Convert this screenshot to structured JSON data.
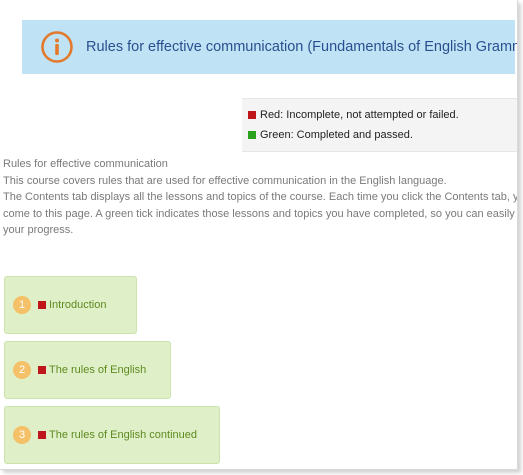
{
  "header": {
    "icon": "info-icon",
    "title": "Rules for effective communication (Fundamentals of English Grammar)"
  },
  "legend": {
    "items": [
      {
        "color": "#c0151a",
        "label": "Red: Incomplete, not attempted or failed."
      },
      {
        "color": "#2aa21d",
        "label": "Green: Completed and passed."
      }
    ]
  },
  "description": {
    "lines": [
      "Rules for effective communication",
      "This course covers rules that are used for effective communication in the English language.",
      "The Contents tab displays all the lessons and topics of the course. Each time you click the Contents tab, you w",
      "come to this page. A green tick indicates those lessons and topics you have completed, so you can easily see",
      "your progress."
    ]
  },
  "lessons": [
    {
      "number": "1",
      "status": "incomplete",
      "label": "Introduction"
    },
    {
      "number": "2",
      "status": "incomplete",
      "label": "The rules of English"
    },
    {
      "number": "3",
      "status": "incomplete",
      "label": "The rules of English continued"
    }
  ],
  "colors": {
    "header_bg": "#bfe3f5",
    "icon_orange": "#e37a2b",
    "lesson_bg": "#dff0c8",
    "number_badge": "#f4c068",
    "status_red": "#c0151a",
    "status_green": "#2aa21d"
  }
}
